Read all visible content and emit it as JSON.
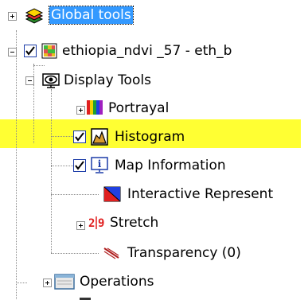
{
  "tree": {
    "items": [
      {
        "label": "Global tools",
        "selected": true,
        "icon": "layers-stack-icon"
      },
      {
        "label": "ethiopia_ndvi _57 - eth_b",
        "checked": true,
        "icon": "raster-map-icon"
      },
      {
        "label": "Display Tools",
        "icon": "display-tools-icon"
      },
      {
        "label": "Portrayal",
        "icon": "color-bars-icon"
      },
      {
        "label": "Histogram",
        "checked": true,
        "icon": "histogram-icon"
      },
      {
        "label": "Map Information",
        "checked": true,
        "icon": "info-icon"
      },
      {
        "label": "Interactive Represent",
        "icon": "interactive-representation-icon"
      },
      {
        "label": "Stretch",
        "icon": "stretch-icon"
      },
      {
        "label": "Transparency (0)",
        "icon": "transparency-icon"
      },
      {
        "label": "Operations",
        "icon": "operations-icon"
      }
    ]
  },
  "colors": {
    "selection": "#3399ff",
    "highlight": "#ffff33",
    "checkbox_border": "#1c3ca8"
  }
}
